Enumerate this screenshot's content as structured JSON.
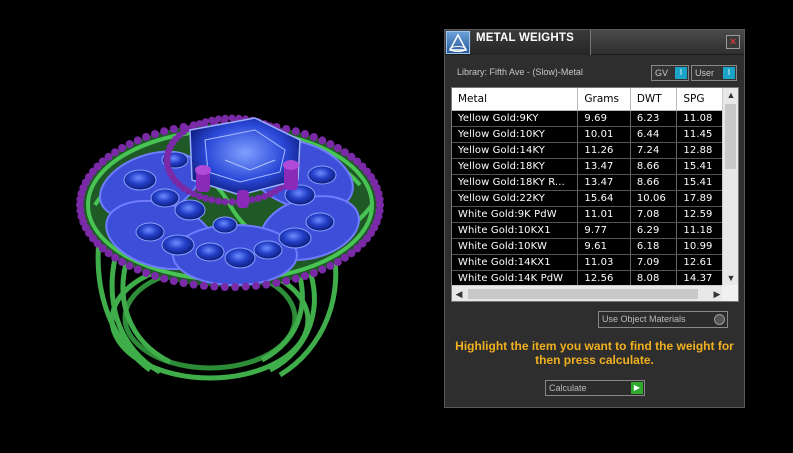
{
  "panel": {
    "title": "METAL WEIGHTS",
    "close_label": "×",
    "library_label": "Library: Fifth Ave - (Slow)-Metal",
    "gv_label": "GV",
    "user_label": "User",
    "use_object_materials_label": "Use Object Materials",
    "hint": "Highlight the item you want to find the weight for then press calculate.",
    "calculate_label": "Calculate"
  },
  "table": {
    "columns": [
      "Metal",
      "Grams",
      "DWT",
      "SPG"
    ],
    "rows": [
      [
        "Yellow Gold:9KY",
        "9.69",
        "6.23",
        "11.08"
      ],
      [
        "Yellow Gold:10KY",
        "10.01",
        "6.44",
        "11.45"
      ],
      [
        "Yellow Gold:14KY",
        "11.26",
        "7.24",
        "12.88"
      ],
      [
        "Yellow Gold:18KY",
        "13.47",
        "8.66",
        "15.41"
      ],
      [
        "Yellow Gold:18KY R...",
        "13.47",
        "8.66",
        "15.41"
      ],
      [
        "Yellow Gold:22KY",
        "15.64",
        "10.06",
        "17.89"
      ],
      [
        "White Gold:9K PdW",
        "11.01",
        "7.08",
        "12.59"
      ],
      [
        "White Gold:10KX1",
        "9.77",
        "6.29",
        "11.18"
      ],
      [
        "White Gold:10KW",
        "9.61",
        "6.18",
        "10.99"
      ],
      [
        "White Gold:14KX1",
        "11.03",
        "7.09",
        "12.61"
      ],
      [
        "White Gold:14K PdW",
        "12.56",
        "8.08",
        "14.37"
      ]
    ]
  },
  "colors": {
    "panel_bg": "#2e2e2e",
    "hint": "#f0b020",
    "ring_metal": "#3fae4a",
    "gem_blue": "#2d4fd0",
    "prong_purple": "#7a2aa6"
  },
  "icons": {
    "app": "triangle-logo-icon",
    "close": "close-icon",
    "calculate": "play-arrow-icon"
  }
}
